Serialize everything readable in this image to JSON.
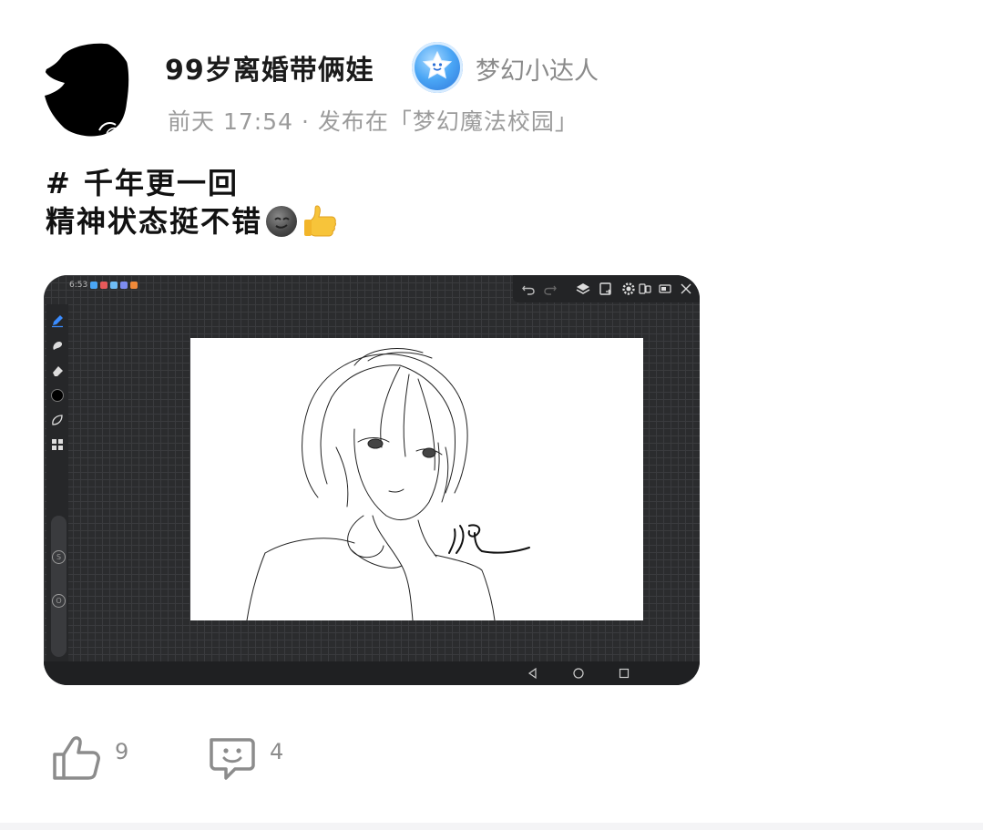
{
  "post": {
    "username": "99岁离婚带俩娃",
    "badge_text": "梦幻小达人",
    "meta": "前天 17:54 · 发布在「梦幻魔法校园」",
    "text_line1": "# 千年更一回",
    "text_line2": "精神状态挺不错",
    "likes": "9",
    "comments": "4"
  },
  "tablet": {
    "status_time": "6:53"
  },
  "colors": {
    "badge_blue": "#3d8df0",
    "muted_gray": "#9b9b9b",
    "tablet_bg": "#2b2c2e",
    "accent_pen": "#3a8cff"
  },
  "icons": {
    "like": "thumbs-up-icon",
    "comment": "comment-smile-icon",
    "badge": "star-badge-icon"
  }
}
